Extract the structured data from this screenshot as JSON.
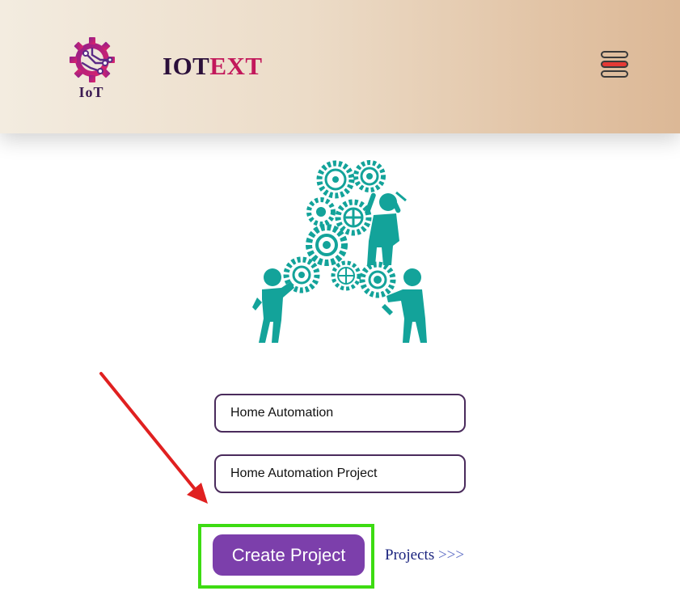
{
  "header": {
    "logo_text": "IoT",
    "brand_part1": "IOT",
    "brand_part2": "EXT",
    "menu_icon": "hamburger-menu-icon"
  },
  "illustration": {
    "icon": "teamwork-gears-icon"
  },
  "form": {
    "project_name_value": "Home Automation",
    "project_description_value": "Home Automation Project",
    "create_button_label": "Create Project",
    "projects_link_label": "Projects",
    "projects_link_arrows": ">>>"
  },
  "annotations": {
    "arrow_color": "#e02020",
    "highlight_color": "#3ddc12"
  },
  "colors": {
    "brand_dark": "#2b0f3a",
    "brand_accent": "#c2185b",
    "button_bg": "#7c3fab",
    "illustration": "#13a39a"
  }
}
